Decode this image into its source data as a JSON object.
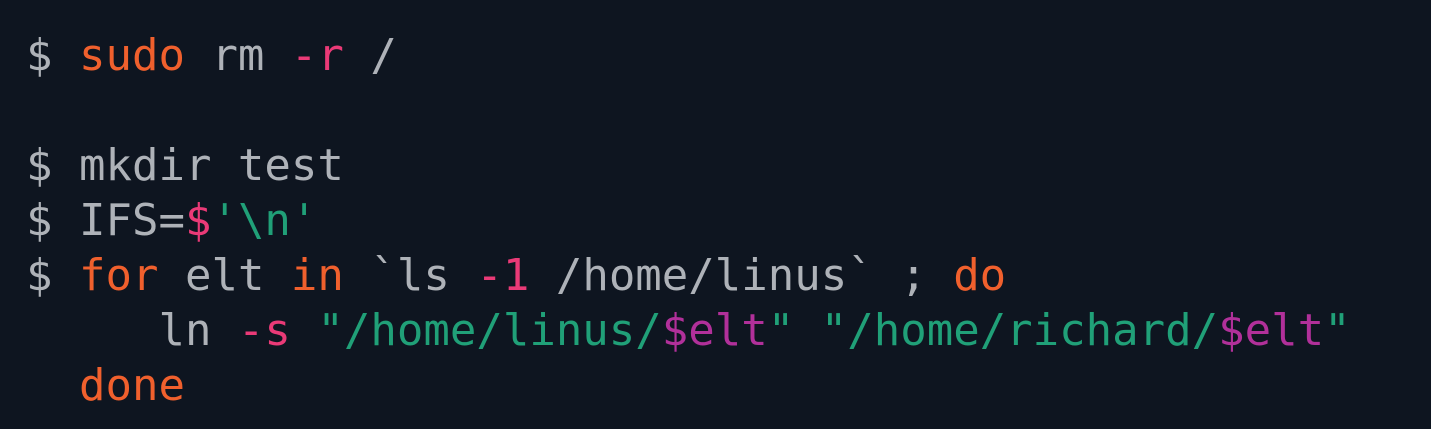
{
  "terminal": {
    "colors": {
      "background": "#0e1520",
      "plain": "#aeb2b8",
      "keyword": "#f0602d",
      "flag": "#ea3a77",
      "string": "#20a078",
      "variable": "#b1309a"
    },
    "lines": [
      [
        {
          "text": "$ ",
          "role": "plain"
        },
        {
          "text": "sudo",
          "role": "keyword"
        },
        {
          "text": " rm ",
          "role": "plain"
        },
        {
          "text": "-r",
          "role": "flag"
        },
        {
          "text": " /",
          "role": "plain"
        }
      ],
      [],
      [
        {
          "text": "$ mkdir test",
          "role": "plain"
        }
      ],
      [
        {
          "text": "$ IFS=",
          "role": "plain"
        },
        {
          "text": "$",
          "role": "flag"
        },
        {
          "text": "'\\n'",
          "role": "string"
        }
      ],
      [
        {
          "text": "$ ",
          "role": "plain"
        },
        {
          "text": "for",
          "role": "keyword"
        },
        {
          "text": " elt ",
          "role": "plain"
        },
        {
          "text": "in",
          "role": "keyword"
        },
        {
          "text": " `ls ",
          "role": "plain"
        },
        {
          "text": "-1",
          "role": "flag"
        },
        {
          "text": " /home/linus` ; ",
          "role": "plain"
        },
        {
          "text": "do",
          "role": "keyword"
        }
      ],
      [
        {
          "text": "     ln ",
          "role": "plain"
        },
        {
          "text": "-s",
          "role": "flag"
        },
        {
          "text": " ",
          "role": "plain"
        },
        {
          "text": "\"/home/linus/",
          "role": "string"
        },
        {
          "text": "$elt",
          "role": "var"
        },
        {
          "text": "\"",
          "role": "string"
        },
        {
          "text": " ",
          "role": "plain"
        },
        {
          "text": "\"/home/richard/",
          "role": "string"
        },
        {
          "text": "$elt",
          "role": "var"
        },
        {
          "text": "\"",
          "role": "string"
        }
      ],
      [
        {
          "text": "  ",
          "role": "plain"
        },
        {
          "text": "done",
          "role": "keyword"
        }
      ]
    ]
  }
}
